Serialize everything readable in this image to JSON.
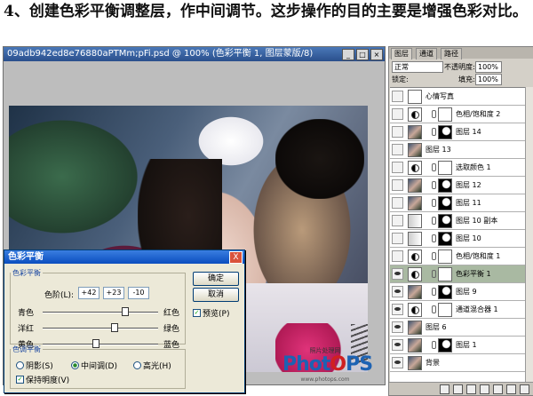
{
  "caption": "4、创建色彩平衡调整层，作中间调节。这步操作的目的主要是增强色彩对比。",
  "document": {
    "title": "09adb942ed8e76880aPTMm;pFi.psd @ 100% (色彩平衡 1, 图层蒙版/8)"
  },
  "logo": {
    "small_text": "照片处理网",
    "brand_blue_1": "Phot",
    "brand_red": "O",
    "brand_blue_2": "PS",
    "url_text": "www.photops.com"
  },
  "dialog": {
    "title": "色彩平衡",
    "close": "X",
    "color_balance_legend": "色彩平衡",
    "levels_label": "色阶(L):",
    "levels": [
      "+42",
      "+23",
      "-10"
    ],
    "sliders": [
      {
        "left": "青色",
        "right": "红色",
        "value": 42
      },
      {
        "left": "洋红",
        "right": "绿色",
        "value": 23
      },
      {
        "left": "黄色",
        "right": "蓝色",
        "value": -10
      }
    ],
    "tone_legend": "色调平衡",
    "tone_options": [
      "阴影(S)",
      "中间调(D)",
      "高光(H)"
    ],
    "tone_selected": 1,
    "preserve_luminosity": "保持明度(V)",
    "preserve_checked": true,
    "ok": "确定",
    "cancel": "取消",
    "preview": "预览(P)",
    "preview_checked": true
  },
  "panel": {
    "tabs": [
      "图层",
      "通道",
      "路径"
    ],
    "blend_mode": "正常",
    "opacity_label": "不透明度:",
    "opacity": "100%",
    "lock_label": "锁定:",
    "fill_label": "填充:",
    "fill": "100%",
    "layers": [
      {
        "name": "心情写真",
        "visible": false,
        "type": "text"
      },
      {
        "name": "色相/饱和度 2",
        "visible": false,
        "type": "adj"
      },
      {
        "name": "图层 14",
        "visible": false,
        "type": "mask-layer"
      },
      {
        "name": "图层 13",
        "visible": false,
        "type": "photo"
      },
      {
        "name": "选取颜色 1",
        "visible": false,
        "type": "adj"
      },
      {
        "name": "图层 12",
        "visible": false,
        "type": "mask-layer"
      },
      {
        "name": "图层 11",
        "visible": false,
        "type": "mask-layer"
      },
      {
        "name": "图层 10 副本",
        "visible": false,
        "type": "grad"
      },
      {
        "name": "图层 10",
        "visible": false,
        "type": "grad"
      },
      {
        "name": "色相/饱和度 1",
        "visible": false,
        "type": "adj"
      },
      {
        "name": "色彩平衡 1",
        "visible": true,
        "type": "adj",
        "selected": true
      },
      {
        "name": "图层 9",
        "visible": true,
        "type": "mask-layer"
      },
      {
        "name": "通道混合器 1",
        "visible": true,
        "type": "adj"
      },
      {
        "name": "图层 6",
        "visible": true,
        "type": "photo"
      },
      {
        "name": "图层 1",
        "visible": true,
        "type": "mask-layer"
      },
      {
        "name": "背景",
        "visible": true,
        "type": "photo"
      }
    ]
  }
}
